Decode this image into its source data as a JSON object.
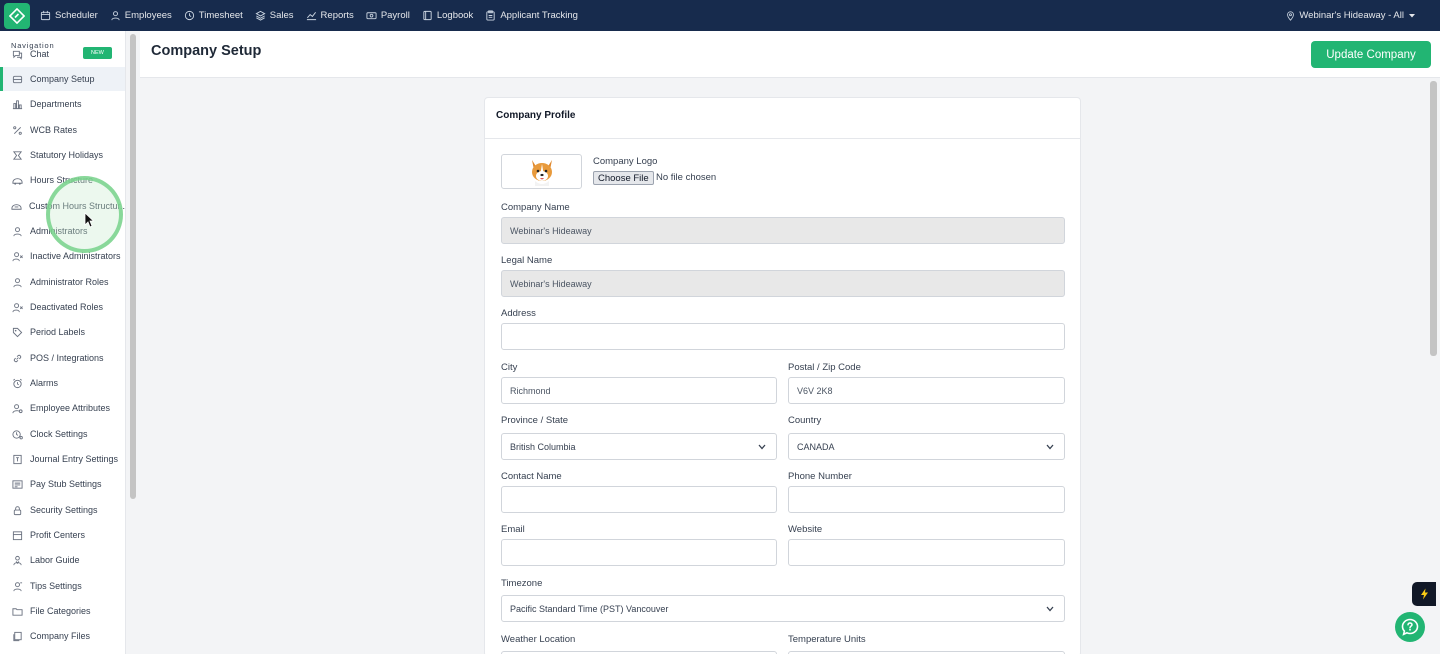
{
  "topnav": {
    "items": [
      {
        "label": "Scheduler",
        "icon": "calendar-icon"
      },
      {
        "label": "Employees",
        "icon": "person-icon"
      },
      {
        "label": "Timesheet",
        "icon": "clock-icon"
      },
      {
        "label": "Sales",
        "icon": "stack-icon"
      },
      {
        "label": "Reports",
        "icon": "chart-line-icon"
      },
      {
        "label": "Payroll",
        "icon": "money-icon"
      },
      {
        "label": "Logbook",
        "icon": "book-icon"
      },
      {
        "label": "Applicant Tracking",
        "icon": "clipboard-icon"
      }
    ],
    "location": "Webinar's Hideaway - All"
  },
  "sidebar": {
    "heading": "Navigation",
    "badge_new": "NEW",
    "items": [
      {
        "label": "Chat",
        "icon": "chat-icon"
      },
      {
        "label": "Company Setup",
        "icon": "database-icon",
        "active": true
      },
      {
        "label": "Departments",
        "icon": "departments-icon"
      },
      {
        "label": "WCB Rates",
        "icon": "percent-icon"
      },
      {
        "label": "Statutory Holidays",
        "icon": "calendar-holiday-icon"
      },
      {
        "label": "Hours Structure",
        "icon": "hours-icon"
      },
      {
        "label": "Custom Hours Structur...",
        "icon": "custom-hours-icon"
      },
      {
        "label": "Administrators",
        "icon": "person-icon"
      },
      {
        "label": "Inactive Administrators",
        "icon": "person-x-icon"
      },
      {
        "label": "Administrator Roles",
        "icon": "person-icon"
      },
      {
        "label": "Deactivated Roles",
        "icon": "person-x-icon"
      },
      {
        "label": "Period Labels",
        "icon": "tag-icon"
      },
      {
        "label": "POS / Integrations",
        "icon": "link-icon"
      },
      {
        "label": "Alarms",
        "icon": "alarm-icon"
      },
      {
        "label": "Employee Attributes",
        "icon": "person-settings-icon"
      },
      {
        "label": "Clock Settings",
        "icon": "clock-settings-icon"
      },
      {
        "label": "Journal Entry Settings",
        "icon": "journal-icon"
      },
      {
        "label": "Pay Stub Settings",
        "icon": "paystub-icon"
      },
      {
        "label": "Security Settings",
        "icon": "lock-icon"
      },
      {
        "label": "Profit Centers",
        "icon": "profit-icon"
      },
      {
        "label": "Labor Guide",
        "icon": "labor-icon"
      },
      {
        "label": "Tips Settings",
        "icon": "tips-icon"
      },
      {
        "label": "File Categories",
        "icon": "folder-icon"
      },
      {
        "label": "Company Files",
        "icon": "files-icon"
      }
    ]
  },
  "header": {
    "title": "Company Setup",
    "update_button": "Update Company"
  },
  "profile": {
    "title": "Company Profile",
    "logo_label": "Company Logo",
    "file_button": "Choose File",
    "file_status": "No file chosen",
    "company_name_label": "Company Name",
    "company_name": "Webinar's Hideaway",
    "legal_name_label": "Legal Name",
    "legal_name": "Webinar's Hideaway",
    "address_label": "Address",
    "address": "",
    "city_label": "City",
    "city": "Richmond",
    "postal_label": "Postal / Zip Code",
    "postal": "V6V 2K8",
    "province_label": "Province / State",
    "province": "British Columbia",
    "country_label": "Country",
    "country": "CANADA",
    "contact_label": "Contact Name",
    "contact": "",
    "phone_label": "Phone Number",
    "phone": "",
    "email_label": "Email",
    "email": "",
    "website_label": "Website",
    "website": "",
    "timezone_label": "Timezone",
    "timezone": "Pacific Standard Time (PST) Vancouver",
    "weather_label": "Weather Location",
    "temperature_label": "Temperature Units"
  },
  "colors": {
    "nav_bg": "#172b4d",
    "accent": "#22b573"
  }
}
